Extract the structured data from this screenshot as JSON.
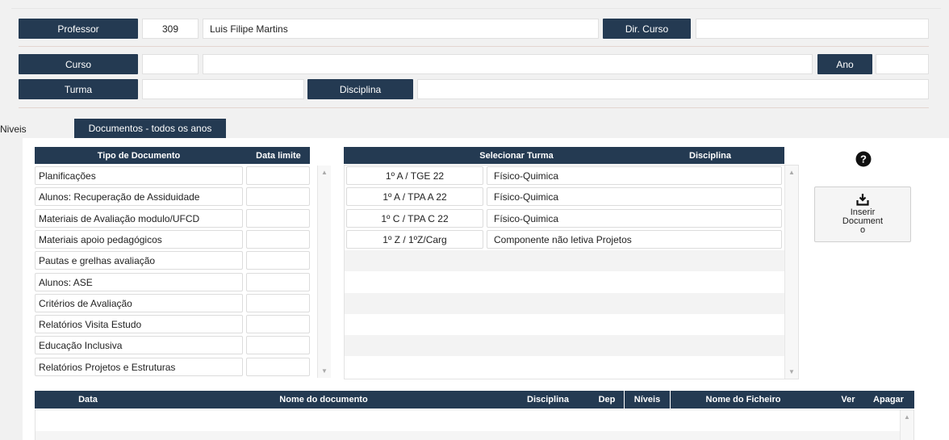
{
  "header": {
    "professor_label": "Professor",
    "professor_id": "309",
    "professor_name": "Luis Filipe Martins",
    "dir_curso_label": "Dir. Curso",
    "dir_curso_value": "",
    "curso_label": "Curso",
    "curso_code": "",
    "curso_name": "",
    "ano_label": "Ano",
    "ano_value": "",
    "turma_label": "Turma",
    "turma_value": "",
    "disciplina_label": "Disciplina",
    "disciplina_value": ""
  },
  "tabs": [
    {
      "label": "Niveis",
      "active": false
    },
    {
      "label": "Documentos - todos os anos",
      "active": true
    }
  ],
  "doc_types": {
    "headers": {
      "tipo": "Tipo de Documento",
      "data_limite": "Data limite"
    },
    "rows": [
      {
        "tipo": "Planificações",
        "data_limite": ""
      },
      {
        "tipo": "Alunos: Recuperação de  Assiduidade",
        "data_limite": ""
      },
      {
        "tipo": "Materiais de Avaliação modulo/UFCD",
        "data_limite": ""
      },
      {
        "tipo": "Materiais apoio pedagógicos",
        "data_limite": ""
      },
      {
        "tipo": "Pautas e grelhas avaliação",
        "data_limite": ""
      },
      {
        "tipo": "Alunos: ASE",
        "data_limite": ""
      },
      {
        "tipo": "Critérios de Avaliação",
        "data_limite": ""
      },
      {
        "tipo": "Relatórios Visita Estudo",
        "data_limite": ""
      },
      {
        "tipo": "Educação Inclusiva",
        "data_limite": ""
      },
      {
        "tipo": "Relatórios Projetos e Estruturas",
        "data_limite": ""
      }
    ]
  },
  "turmas": {
    "headers": {
      "turma": "Selecionar Turma",
      "disciplina": "Disciplina"
    },
    "rows": [
      {
        "turma": "1º A / TGE 22",
        "disciplina": "Físico-Quimica"
      },
      {
        "turma": "1º A / TPA A 22",
        "disciplina": "Físico-Quimica"
      },
      {
        "turma": "1º C / TPA C 22",
        "disciplina": "Físico-Quimica"
      },
      {
        "turma": "1º Z / 1ºZ/Carg",
        "disciplina": "Componente não letiva Projetos"
      }
    ]
  },
  "actions": {
    "help_icon": "question-circle-icon",
    "insert_icon": "upload-tray-icon",
    "insert_line1": "Inserir",
    "insert_line2": "Document",
    "insert_line3": "o"
  },
  "documents_table": {
    "headers": {
      "data": "Data",
      "nome": "Nome do documento",
      "disciplina": "Disciplina",
      "dep": "Dep",
      "niveis": "Níveis",
      "ficheiro": "Nome do Ficheiro",
      "ver": "Ver",
      "apagar": "Apagar"
    }
  },
  "colors": {
    "label_bg": "#243a52",
    "page_bg": "#f1f1f1",
    "divider": "#e3d6d0"
  }
}
